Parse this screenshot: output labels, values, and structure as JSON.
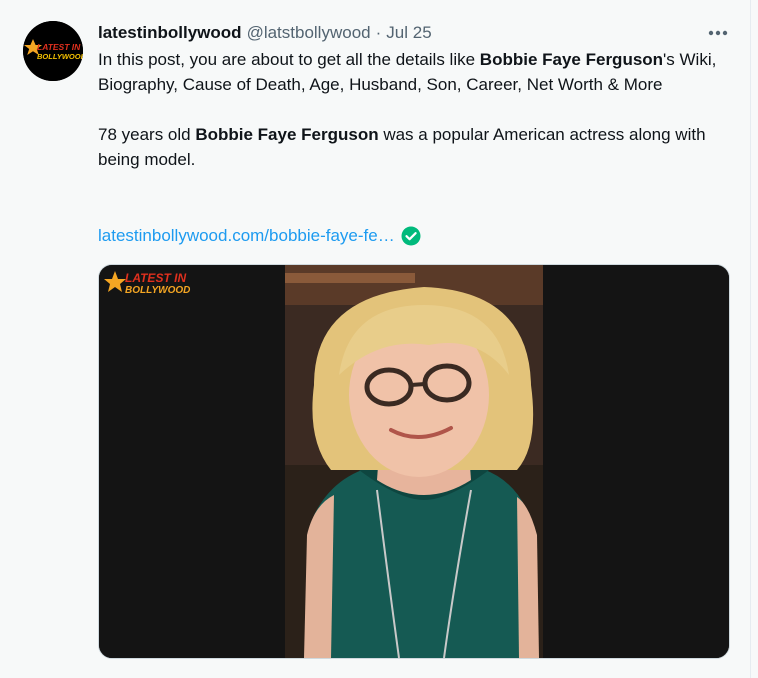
{
  "tweet": {
    "display_name": "latestinbollywood",
    "handle": "@latstbollywood",
    "separator": "·",
    "date": "Jul 25",
    "more_label": "More",
    "text": {
      "p1_start": "In this post, you are about to get all the details like ",
      "p1_bold": "Bobbie Faye Ferguson",
      "p1_end": "'s Wiki, Biography, Cause of Death, Age, Husband, Son, Career, Net Worth & More",
      "p2_start": "78 years old ",
      "p2_bold": "Bobbie Faye Ferguson",
      "p2_end": " was a popular American actress along with being model."
    },
    "link": "latestinbollywood.com/bobbie-faye-fe…",
    "avatar_logo": {
      "line1": "LATEST IN",
      "line2": "BOLLYWOOD"
    },
    "media": {
      "watermark_line1": "LATEST IN",
      "watermark_line2": "BOLLYWOOD"
    }
  },
  "colors": {
    "background": "#f7f9f9",
    "text": "#0f1419",
    "secondary": "#536471",
    "link": "#1d9bf0",
    "verified_green": "#00ba7c",
    "logo_red": "#e0301e",
    "logo_gold": "#f5a623"
  },
  "icons": {
    "more": "ellipsis-icon",
    "link_check": "check-circle-icon",
    "logo_star": "star-icon"
  }
}
